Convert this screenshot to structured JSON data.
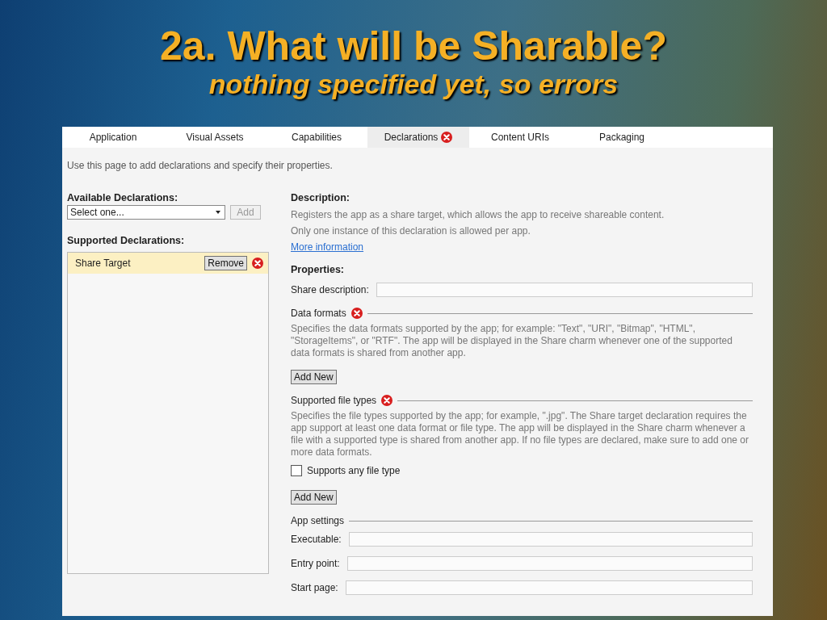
{
  "slide": {
    "title": "2a. What will be Sharable?",
    "subtitle": "nothing specified yet, so errors"
  },
  "tabs": [
    {
      "label": "Application",
      "selected": false,
      "error": false
    },
    {
      "label": "Visual Assets",
      "selected": false,
      "error": false
    },
    {
      "label": "Capabilities",
      "selected": false,
      "error": false
    },
    {
      "label": "Declarations",
      "selected": true,
      "error": true
    },
    {
      "label": "Content URIs",
      "selected": false,
      "error": false
    },
    {
      "label": "Packaging",
      "selected": false,
      "error": false
    }
  ],
  "intro": "Use this page to add declarations and specify their properties.",
  "available": {
    "label": "Available Declarations:",
    "dropdown": "Select one...",
    "add_button": {
      "label": "Add",
      "disabled": true
    }
  },
  "supported": {
    "label": "Supported Declarations:",
    "items": [
      {
        "name": "Share Target",
        "selected": true,
        "button": "Remove",
        "error": true
      }
    ]
  },
  "details": [
    {
      "kind": "heading",
      "text": "Description:"
    },
    {
      "kind": "text",
      "text": "Registers the app as a share target, which allows the app to receive shareable content."
    },
    {
      "kind": "text",
      "text": "Only one instance of this declaration is allowed per app."
    },
    {
      "kind": "link",
      "text": "More information"
    },
    {
      "kind": "heading",
      "text": "Properties:"
    },
    {
      "kind": "field",
      "text": "Share description:"
    },
    {
      "kind": "section",
      "text": "Data formats",
      "error": true
    },
    {
      "kind": "text",
      "text": "Specifies the data formats supported by the app; for example: \"Text\", \"URI\", \"Bitmap\", \"HTML\", \"StorageItems\", or \"RTF\". The app will be displayed in the Share charm whenever one of the supported data formats is shared from another app."
    },
    {
      "kind": "button",
      "text": "Add New"
    },
    {
      "kind": "section",
      "text": "Supported file types",
      "error": true
    },
    {
      "kind": "text",
      "text": "Specifies the file types supported by the app; for example, \".jpg\". The Share target declaration requires the app support at least one data format or file type. The app will be displayed in the Share charm whenever a file with a supported type is shared from another app. If no file types are declared, make sure to add one or more data formats."
    },
    {
      "kind": "checkbox",
      "text": "Supports any file type",
      "checked": false
    },
    {
      "kind": "button",
      "text": "Add New"
    },
    {
      "kind": "section",
      "text": "App settings",
      "error": false
    },
    {
      "kind": "field",
      "text": "Executable:"
    },
    {
      "kind": "field",
      "text": "Entry point:"
    },
    {
      "kind": "field",
      "text": "Start page:"
    }
  ]
}
